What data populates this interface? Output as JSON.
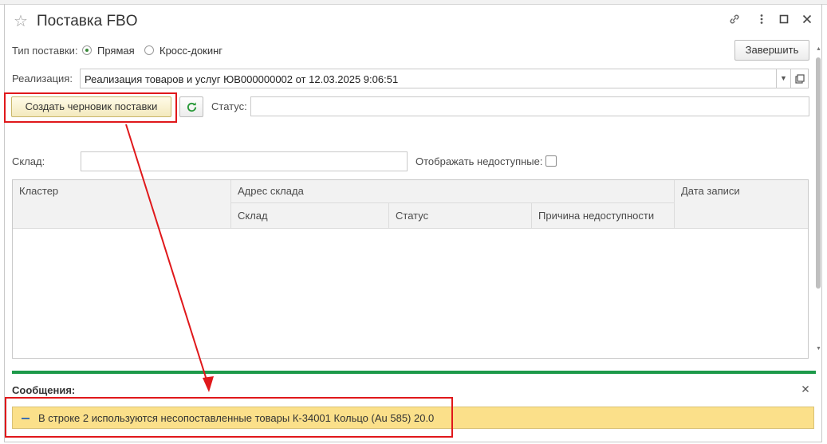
{
  "window": {
    "title": "Поставка FBO",
    "icons": [
      "star-icon",
      "link-icon",
      "more-icon",
      "maximize-icon",
      "close-icon"
    ]
  },
  "toolbar": {
    "finish_label": "Завершить"
  },
  "supply_type": {
    "label": "Тип поставки:",
    "options": [
      {
        "label": "Прямая",
        "selected": true
      },
      {
        "label": "Кросс-докинг",
        "selected": false
      }
    ]
  },
  "realization": {
    "label": "Реализация:",
    "value": "Реализация товаров и услуг ЮВ000000002 от 12.03.2025 9:06:51"
  },
  "draft": {
    "button_label": "Создать черновик поставки",
    "status_label": "Статус:",
    "status_value": ""
  },
  "warehouse": {
    "label": "Склад:",
    "value": "",
    "show_unavailable_label": "Отображать недоступные:",
    "show_unavailable": false
  },
  "table": {
    "col_cluster": "Кластер",
    "col_address_group": "Адрес склада",
    "col_warehouse": "Склад",
    "col_status": "Статус",
    "col_reason": "Причина недоступности",
    "col_date": "Дата записи",
    "rows": []
  },
  "messages": {
    "title": "Сообщения:",
    "items": [
      {
        "text": "В строке 2 используются несопоставленные товары К-34001 Кольцо (Au 585) 20.0"
      }
    ]
  },
  "colors": {
    "accent_green": "#1d9a4a",
    "highlight_red": "#e0181b",
    "message_bg": "#fbe08a"
  }
}
